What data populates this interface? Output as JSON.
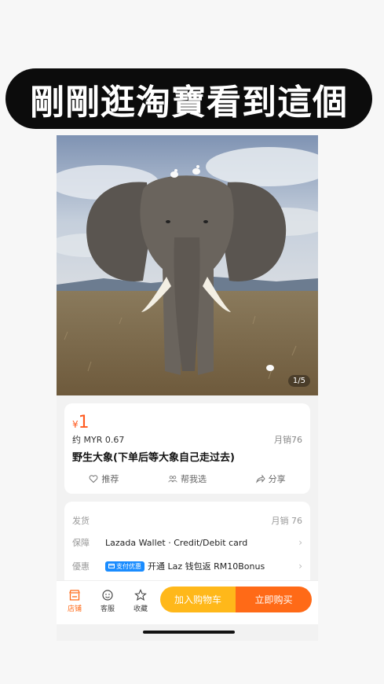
{
  "banner": {
    "text": "剛剛逛淘寶看到這個"
  },
  "image": {
    "counter": "1/5"
  },
  "product": {
    "currency": "¥",
    "price": "1",
    "myr": "约 MYR 0.67",
    "monthly_sales": "月销76",
    "title": "野生大象(下单后等大象自己走过去)"
  },
  "actions": [
    {
      "label": "推荐",
      "icon": "heart-icon"
    },
    {
      "label": "帮我选",
      "icon": "people-icon"
    },
    {
      "label": "分享",
      "icon": "share-icon"
    }
  ],
  "shipping": {
    "ship_label": "发货",
    "ship_sales": "月销 76",
    "guarantee_label": "保障",
    "guarantee_text": "Lazada Wallet · Credit/Debit card",
    "promo_label": "優惠",
    "promo_tag": "支付优惠",
    "promo_text": "开通 Laz 钱包返 RM10Bonus"
  },
  "bottom": {
    "store": "店铺",
    "service": "客服",
    "favorite": "收藏",
    "add_to_cart": "加入购物车",
    "buy_now": "立即购买"
  },
  "colors": {
    "accent_orange": "#ff6a17",
    "accent_yellow": "#ffb81a",
    "price_color": "#ff5a1f"
  }
}
